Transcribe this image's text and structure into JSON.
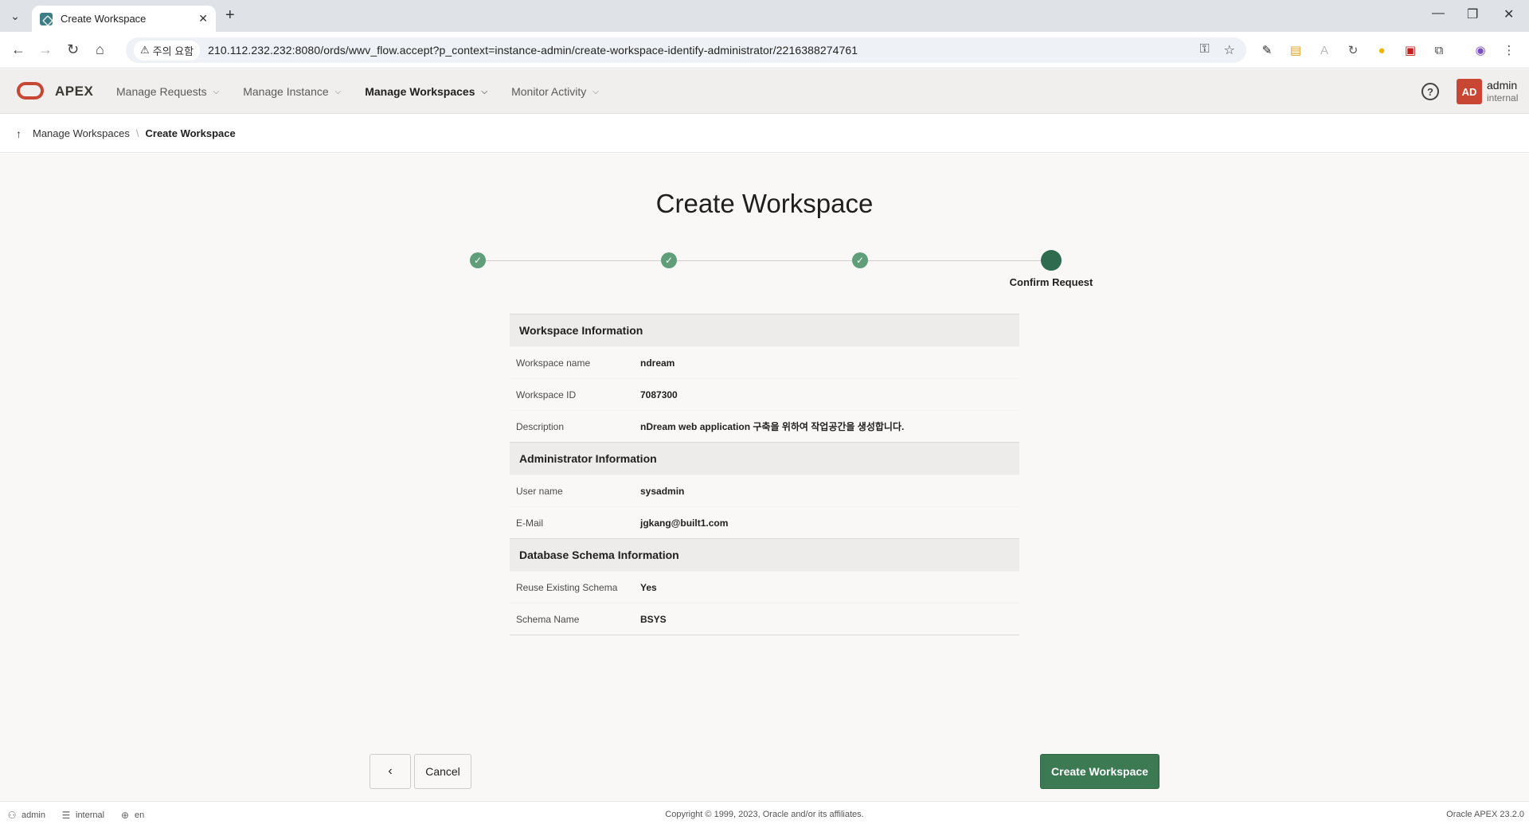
{
  "browser": {
    "tab_title": "Create Workspace",
    "security_label": "주의 요함",
    "url": "210.112.232.232:8080/ords/wwv_flow.accept?p_context=instance-admin/create-workspace-identify-administrator/2216388274761"
  },
  "header": {
    "logo_text": "APEX",
    "nav": [
      {
        "label": "Manage Requests",
        "active": false
      },
      {
        "label": "Manage Instance",
        "active": false
      },
      {
        "label": "Manage Workspaces",
        "active": true
      },
      {
        "label": "Monitor Activity",
        "active": false
      }
    ],
    "avatar_initials": "AD",
    "user_name": "admin",
    "workspace": "internal"
  },
  "breadcrumb": {
    "parent": "Manage Workspaces",
    "current": "Create Workspace"
  },
  "page": {
    "title": "Create Workspace",
    "current_step_label": "Confirm Request"
  },
  "summary": {
    "workspace_section": "Workspace Information",
    "workspace_name_label": "Workspace name",
    "workspace_name": "ndream",
    "workspace_id_label": "Workspace ID",
    "workspace_id": "7087300",
    "description_label": "Description",
    "description": "nDream web application 구축을 위하여 작업공간을 생성합니다.",
    "admin_section": "Administrator Information",
    "user_name_label": "User name",
    "user_name": "sysadmin",
    "email_label": "E-Mail",
    "email": "jgkang@built1.com",
    "schema_section": "Database Schema Information",
    "reuse_label": "Reuse Existing Schema",
    "reuse": "Yes",
    "schema_name_label": "Schema Name",
    "schema_name": "BSYS"
  },
  "buttons": {
    "back": "‹",
    "cancel": "Cancel",
    "create": "Create Workspace"
  },
  "footer": {
    "user": "admin",
    "workspace": "internal",
    "language": "en",
    "copyright": "Copyright © 1999, 2023, Oracle and/or its affiliates.",
    "version": "Oracle APEX 23.2.0"
  },
  "colors": {
    "brand_red": "#c74634",
    "step_done": "#5f9e78",
    "primary_button": "#3b7a52"
  }
}
